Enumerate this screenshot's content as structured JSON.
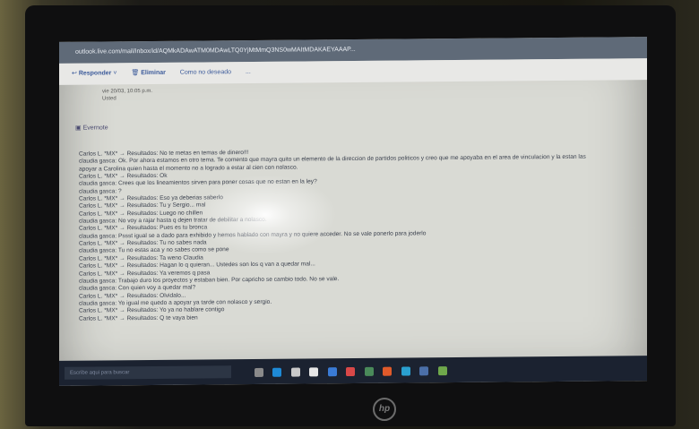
{
  "browser": {
    "url": "outlook.live.com/mail/inbox/id/AQMkADAwATM0MDAwLTQ0YjMtMmQ3NS0wMAItMDAKAEYAAAP..."
  },
  "toolbar": {
    "reply_label": "Responder",
    "delete_label": "Eliminar",
    "mark_label": "Como no deseado",
    "more_label": "..."
  },
  "message": {
    "meta_line1": "vie 20/03, 10:05 p.m.",
    "meta_line2": "Usted",
    "attachment_label": "Evernote"
  },
  "chat_lines": [
    "Carlos L. *MX* → Resultados: No te metas en temas de dinero!!!",
    "claudia gasca: Ok. Por ahora estamos en otro tema. Te comento que mayra quito un elemento de la direccion de partidos politicos y creo que me apoyaba en el area de vinculacion y la estan las",
    "apoyar a Carolina quien hasta el momento no a logrado a estar al cien con nolasco.",
    "Carlos L. *MX* → Resultados: Ok",
    "claudia gasca: Crees que los lineamientos sirven para poner cosas que no estan en la ley?",
    "claudia gasca: ?",
    "Carlos L. *MX* → Resultados: Eso ya deberias saberlo",
    "Carlos L. *MX* → Resultados: Tu y Sergio... mal",
    "Carlos L. *MX* → Resultados: Luego no chillen",
    "claudia gasca: No voy a rajar hasta q dejen tratar de debilitar a nolasco.",
    "Carlos L. *MX* → Resultados: Pues es tu bronca",
    "claudia gasca: Pssst igual se a dado para exhibido y hemos hablado con mayra y no quiere acceder. No se vale ponerlo para joderlo",
    "Carlos L. *MX* → Resultados: Tu no sabes nada",
    "claudia gasca: Tu no estas aca y no sabes como se pone",
    "Carlos L. *MX* → Resultados: Ta weno Claudia",
    "Carlos L. *MX* → Resultados: Hagan lo q quieran... Ustedes son los q van a quedar mal...",
    "Carlos L. *MX* → Resultados: Ya veremos q pasa",
    "claudia gasca: Trabajo duro los proyectos y estaban bien. Por capricho se cambio todo. No se vale.",
    "claudia gasca: Con quien voy a quedar mal?",
    "Carlos L. *MX* → Resultados: Olvidalo...",
    "claudia gasca: Yo igual me quedo a apoyar ya tarde con nolasco y sergio.",
    "Carlos L. *MX* → Resultados: Yo ya no hablare contigo",
    "Carlos L. *MX* → Resultados: Q te vaya bien"
  ],
  "taskbar": {
    "search_placeholder": "Escribe aqui para buscar"
  },
  "laptop": {
    "brand": "hp"
  },
  "colors": {
    "taskbar": "#1b2230",
    "url_bar": "#5f6a78",
    "screen": "#d9dad4"
  }
}
